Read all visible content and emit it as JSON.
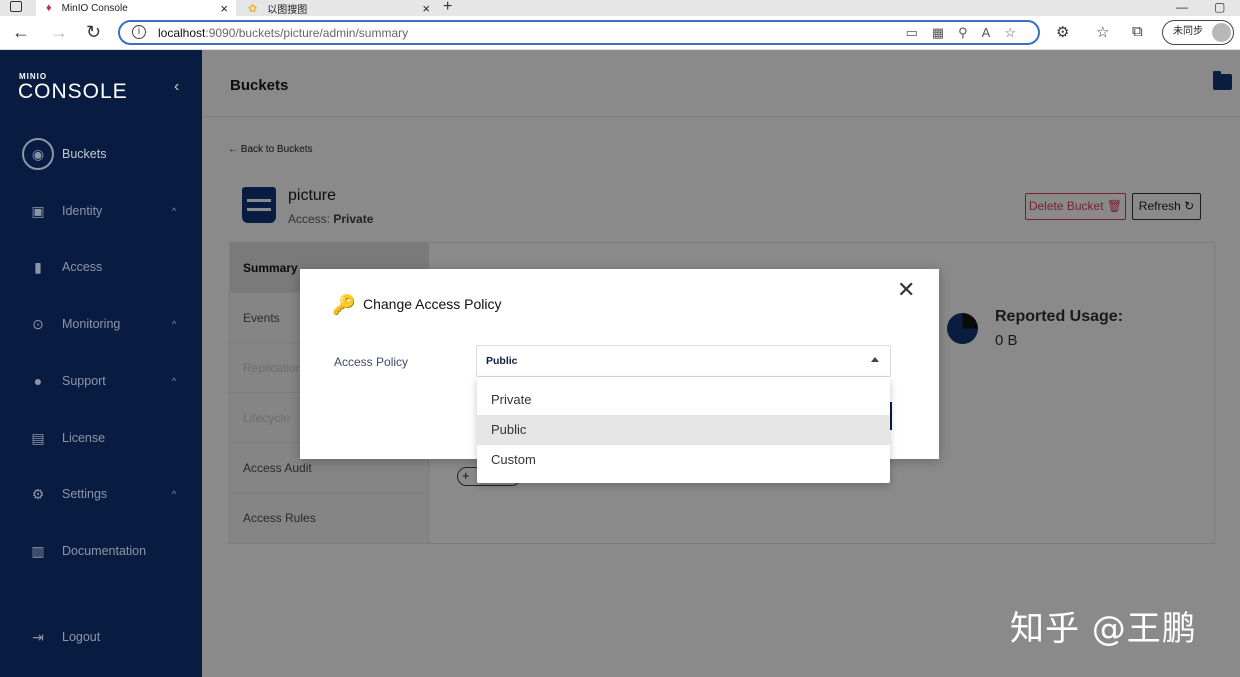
{
  "browser": {
    "tabs": [
      {
        "title": "MinIO Console",
        "active": true
      },
      {
        "title": "以图搜图",
        "active": false
      }
    ],
    "url_host": "localhost",
    "url_path": ":9090/buckets/picture/admin/summary",
    "sync_label": "未同步"
  },
  "sidebar": {
    "logo_small": "MINIO",
    "logo_big": "CONSOLE",
    "items": [
      {
        "label": "Buckets",
        "icon": "bucket-icon"
      },
      {
        "label": "Identity",
        "icon": "identity-icon"
      },
      {
        "label": "Access",
        "icon": "lock-icon"
      },
      {
        "label": "Monitoring",
        "icon": "monitor-icon"
      },
      {
        "label": "Support",
        "icon": "support-icon"
      },
      {
        "label": "License",
        "icon": "license-icon"
      },
      {
        "label": "Settings",
        "icon": "gear-icon"
      },
      {
        "label": "Documentation",
        "icon": "docs-icon"
      },
      {
        "label": "Logout",
        "icon": "logout-icon"
      }
    ]
  },
  "header": {
    "title": "Buckets"
  },
  "bucket": {
    "back_label": "Back to Buckets",
    "name": "picture",
    "access_prefix": "Access:",
    "access_value": "Private",
    "delete_label": "Delete Bucket",
    "refresh_label": "Refresh"
  },
  "tabs": [
    {
      "label": "Summary"
    },
    {
      "label": "Events"
    },
    {
      "label": "Replication"
    },
    {
      "label": "Lifecycle"
    },
    {
      "label": "Access Audit"
    },
    {
      "label": "Access Rules"
    }
  ],
  "usage": {
    "label": "Reported Usage:",
    "value": "0 B"
  },
  "modal": {
    "title": "Change Access Policy",
    "field_label": "Access Policy",
    "selected": "Public",
    "options": [
      "Private",
      "Public",
      "Custom"
    ]
  },
  "watermark": "知乎 @王鹏",
  "colors": {
    "sidebar": "#081c42",
    "accent": "#3b6fc4",
    "danger": "#7a1f2d"
  }
}
